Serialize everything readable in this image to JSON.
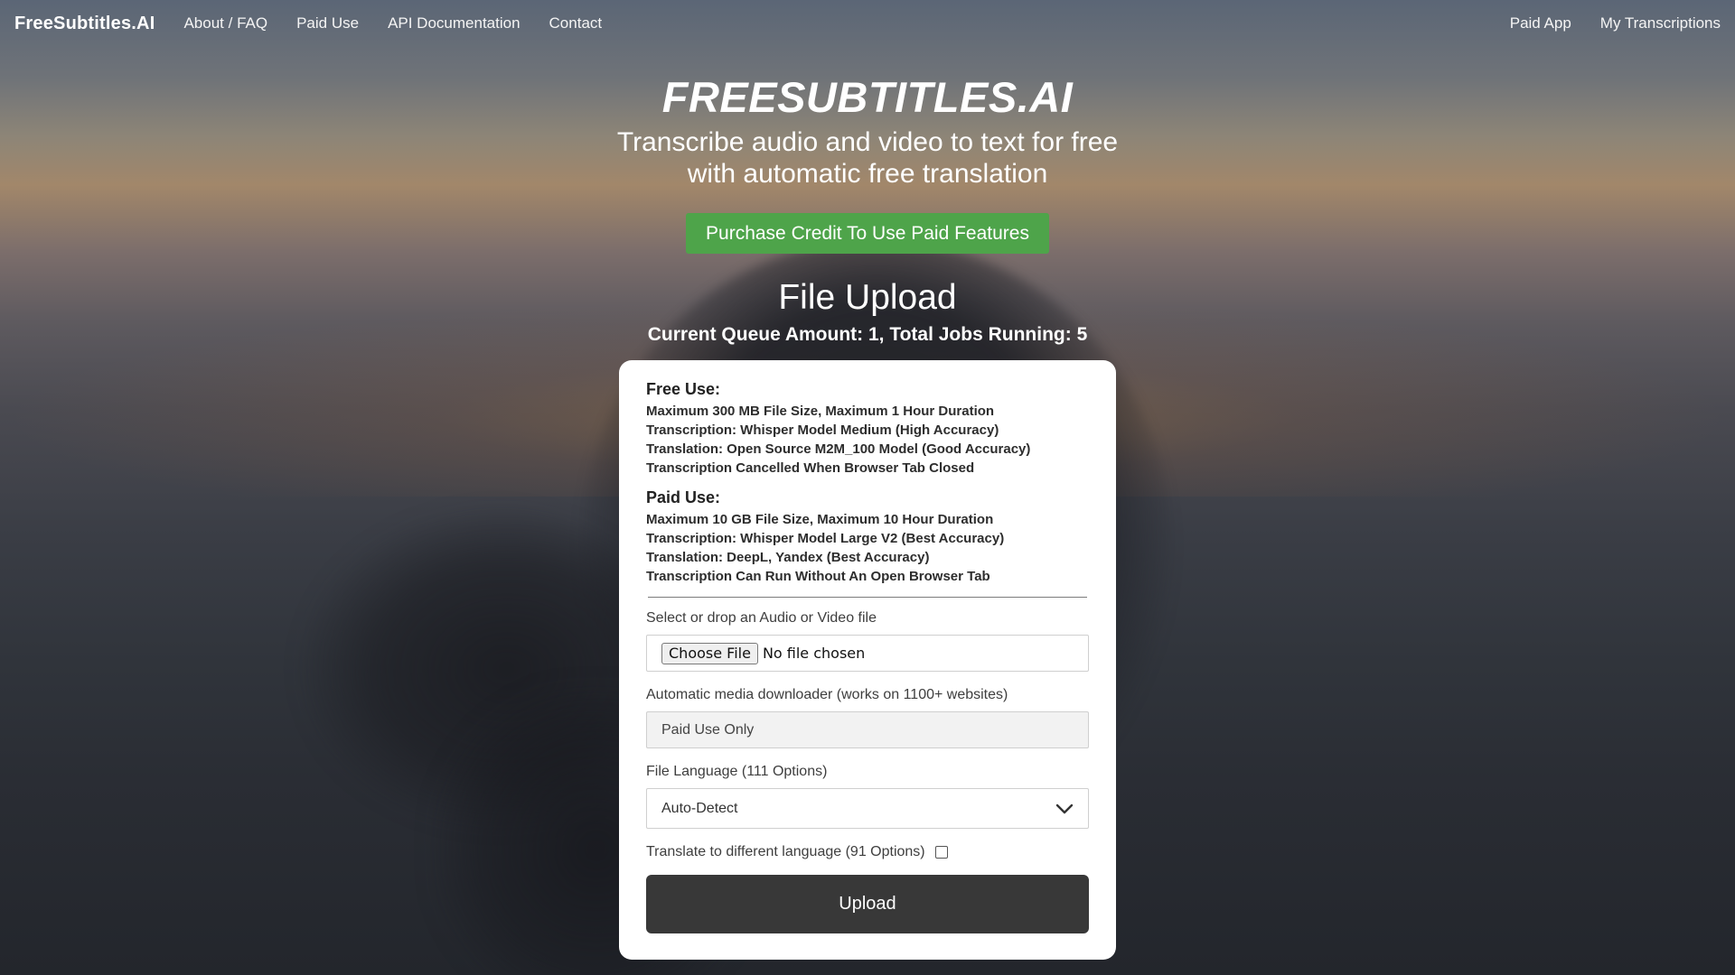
{
  "nav": {
    "brand": "FreeSubtitles.AI",
    "links": [
      "About / FAQ",
      "Paid Use",
      "API Documentation",
      "Contact"
    ],
    "right_links": [
      "Paid App",
      "My Transcriptions"
    ]
  },
  "hero": {
    "title": "FREESUBTITLES.AI",
    "subtitle": "Transcribe audio and video to text for free with automatic free translation",
    "purchase_button": "Purchase Credit To Use Paid Features",
    "upload_title": "File Upload",
    "queue_status": "Current Queue Amount: 1, Total Jobs Running: 5"
  },
  "card": {
    "free": {
      "heading": "Free Use:",
      "lines": [
        "Maximum 300 MB File Size, Maximum 1 Hour Duration",
        "Transcription: Whisper Model Medium (High Accuracy)",
        "Translation: Open Source M2M_100 Model (Good Accuracy)",
        "Transcription Cancelled When Browser Tab Closed"
      ]
    },
    "paid": {
      "heading": "Paid Use:",
      "lines": [
        "Maximum 10 GB File Size, Maximum 10 Hour Duration",
        "Transcription: Whisper Model Large V2 (Best Accuracy)",
        "Translation: DeepL, Yandex (Best Accuracy)",
        "Transcription Can Run Without An Open Browser Tab"
      ]
    },
    "file_label": "Select or drop an Audio or Video file",
    "choose_file": "Choose File",
    "no_file": "No file chosen",
    "downloader_label": "Automatic media downloader (works on 1100+ websites)",
    "downloader_value": "Paid Use Only",
    "language_label": "File Language (111 Options)",
    "language_value": "Auto-Detect",
    "translate_label": "Translate to different language (91 Options)",
    "translate_checked": false,
    "upload_button": "Upload"
  },
  "colors": {
    "purchase_button": "#4ea44a",
    "upload_button": "#383838"
  }
}
